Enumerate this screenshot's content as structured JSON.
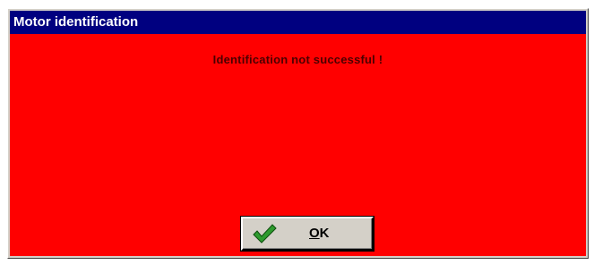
{
  "window": {
    "title": "Motor identification"
  },
  "message": {
    "text": "Identification not successful !"
  },
  "ok_button": {
    "mnemonic": "O",
    "rest": "K",
    "icon": "checkmark-icon"
  },
  "colors": {
    "title_bar": "#000080",
    "body_background": "#ff0000",
    "checkmark": "#2e9b2e"
  }
}
